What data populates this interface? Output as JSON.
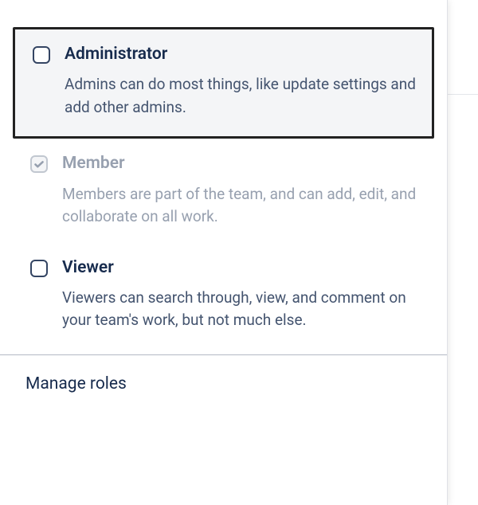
{
  "roles": [
    {
      "key": "administrator",
      "title": "Administrator",
      "description": "Admins can do most things, like update settings and add other admins.",
      "checked": false,
      "highlighted": true,
      "disabled": false
    },
    {
      "key": "member",
      "title": "Member",
      "description": "Members are part of the team, and can add, edit, and collaborate on all work.",
      "checked": true,
      "highlighted": false,
      "disabled": true
    },
    {
      "key": "viewer",
      "title": "Viewer",
      "description": "Viewers can search through, view, and comment on your team's work, but not much else.",
      "checked": false,
      "highlighted": false,
      "disabled": false
    }
  ],
  "footer": {
    "manage_roles_label": "Manage roles"
  }
}
